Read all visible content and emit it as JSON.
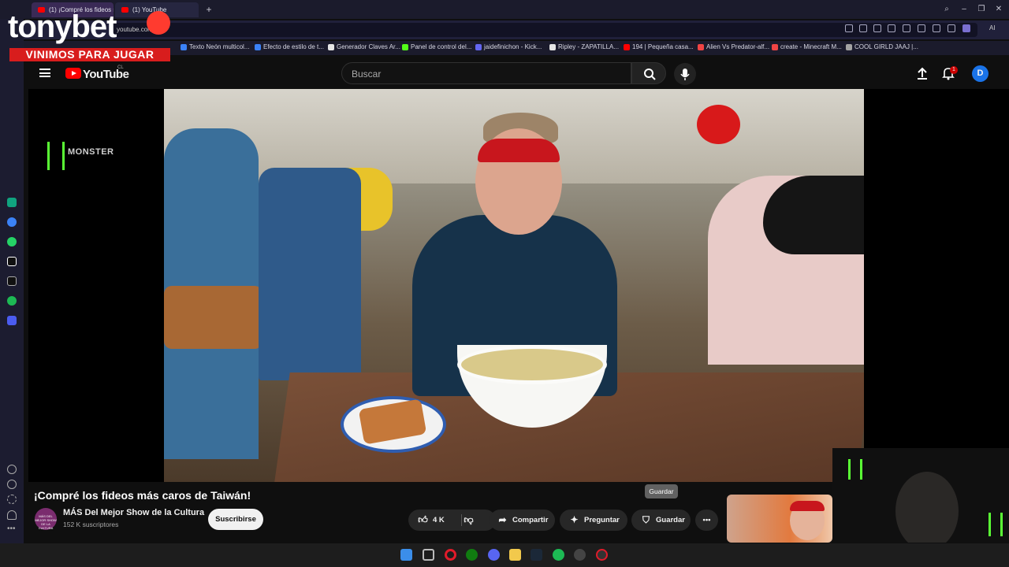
{
  "browser": {
    "tabs": [
      {
        "label": "(1) ¡Compré los fideos má"
      },
      {
        "label": "(1) YouTube"
      }
    ],
    "url": "youtube.com/",
    "toolbar_label": "AI",
    "bookmarks": [
      {
        "label": "Texto Neón multicol...",
        "color": "#3b82f6"
      },
      {
        "label": "Efecto de estilo de t...",
        "color": "#3b82f6"
      },
      {
        "label": "Generador Claves Ar...",
        "color": "#e5e5e5"
      },
      {
        "label": "Panel de control del...",
        "color": "#53fc18"
      },
      {
        "label": "jaidefinichon - Kick...",
        "color": "#6366f1"
      },
      {
        "label": "Ripley - ZAPATILLA...",
        "color": "#e5e5e5"
      },
      {
        "label": "194 | Pequeña casa...",
        "color": "#ff0000"
      },
      {
        "label": "Alien Vs Predator-alf...",
        "color": "#ef4444"
      },
      {
        "label": "create - Minecraft M...",
        "color": "#ef4444"
      },
      {
        "label": "COOL GIRLD JAAJ |...",
        "color": "#a3a3a3"
      }
    ]
  },
  "overlay": {
    "brand": "tonybet",
    "banner": "VINIMOS PARA JUGAR",
    "sponsor": "MONSTER"
  },
  "youtube": {
    "logo": "YouTube",
    "country": "CL",
    "search_placeholder": "Buscar",
    "notifications": "1",
    "avatar_letter": "D"
  },
  "video": {
    "title": "¡Compré los fideos más caros de Taiwán!",
    "channel": "MÁS Del Mejor Show de la Cultura",
    "channel_avatar_text": "MÁS DEL MEJOR SHOW DE LA CULTURA",
    "subscribers": "152 K suscriptores",
    "subscribe_label": "Suscribirse",
    "likes": "4 K",
    "share_label": "Compartir",
    "ask_label": "Preguntar",
    "save_label": "Guardar",
    "save_tooltip": "Guardar"
  },
  "colors": {
    "accent_red": "#ff0000",
    "subscribe_bg": "#f1f1f1",
    "pill_bg": "#272727"
  }
}
